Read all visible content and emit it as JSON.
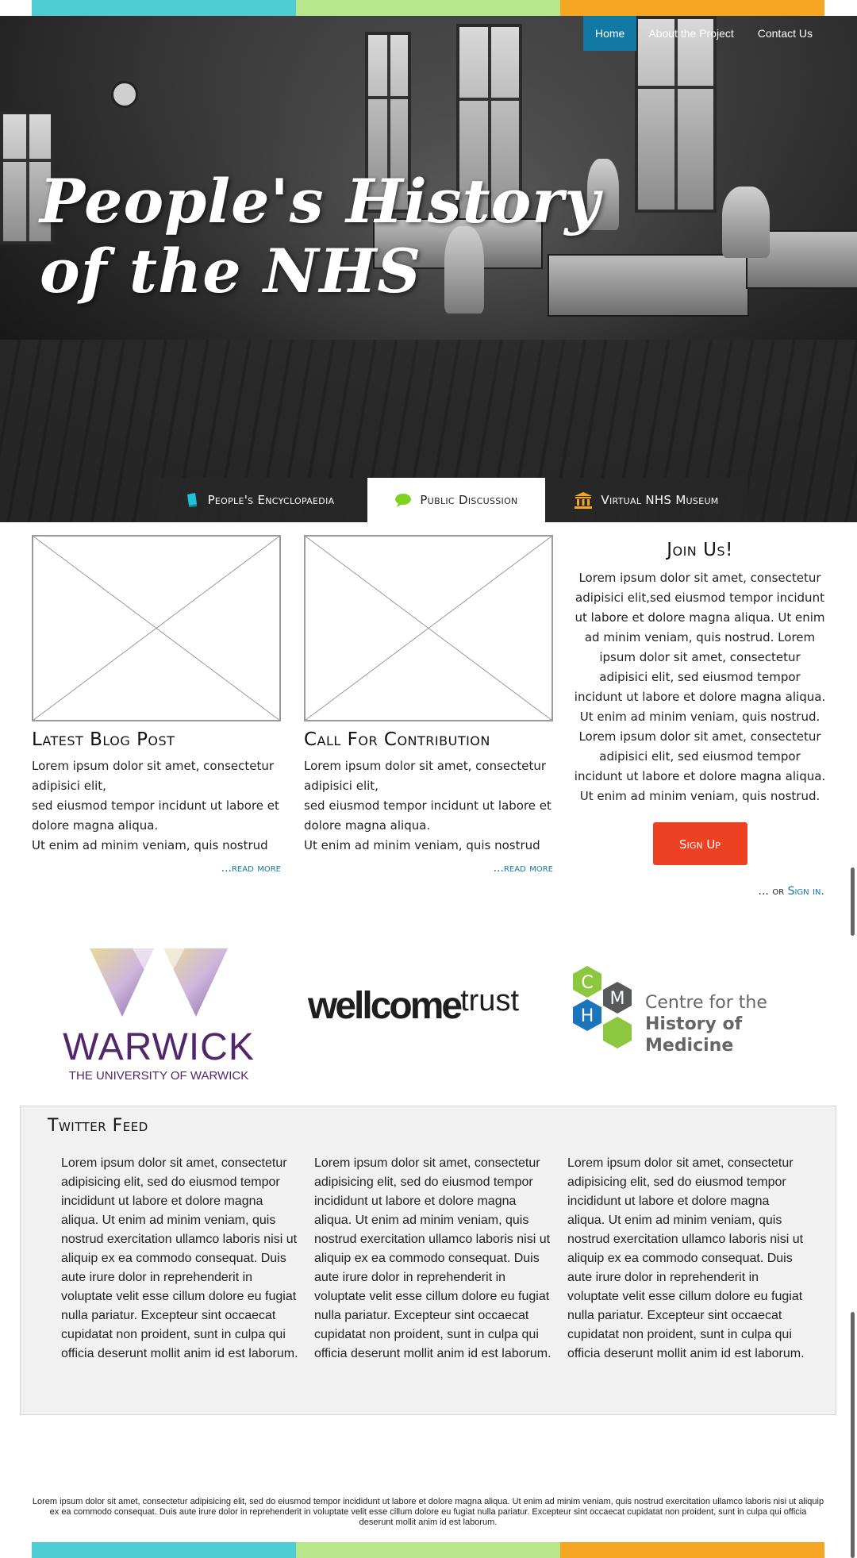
{
  "colors": {
    "teal": "#4ecdd4",
    "green": "#b8e68a",
    "orange": "#f5a623",
    "nav_active": "#1279a4",
    "signup": "#ee4124",
    "link": "#1279a4"
  },
  "nav": {
    "items": [
      {
        "label": "Home",
        "active": true
      },
      {
        "label": "About the Project",
        "active": false
      },
      {
        "label": "Contact Us",
        "active": false
      }
    ]
  },
  "hero": {
    "title_line1": "People's History",
    "title_line2": "of the NHS"
  },
  "tabs": [
    {
      "label": "People's Encyclopaedia",
      "icon": "book-icon",
      "active": false
    },
    {
      "label": "Public Discussion",
      "icon": "speech-bubble-icon",
      "active": true
    },
    {
      "label": "Virtual NHS Museum",
      "icon": "museum-icon",
      "active": false
    }
  ],
  "cards": [
    {
      "title": "Latest Blog Post",
      "body": "Lorem ipsum dolor sit amet, consectetur adipisici elit,\nsed eiusmod tempor incidunt ut labore et dolore magna aliqua.\nUt enim ad minim veniam, quis nostrud",
      "read_more": "...read more"
    },
    {
      "title": "Call For Contribution",
      "body": "Lorem ipsum dolor sit amet, consectetur adipisici elit,\nsed eiusmod tempor incidunt ut labore et dolore magna aliqua.\nUt enim ad minim veniam, quis nostrud",
      "read_more": "...read more"
    }
  ],
  "join": {
    "title": "Join Us!",
    "body": "Lorem ipsum dolor sit amet, consectetur adipisici elit,sed eiusmod tempor incidunt ut labore et dolore magna aliqua. Ut enim ad minim veniam, quis nostrud. Lorem ipsum dolor sit amet, consectetur adipisici elit, sed eiusmod tempor incidunt ut labore et dolore magna aliqua. Ut enim ad minim veniam, quis nostrud. Lorem ipsum dolor sit amet, consectetur adipisici elit, sed eiusmod tempor incidunt ut labore et dolore magna aliqua. Ut enim ad minim veniam, quis nostrud.",
    "signup_label": "Sign Up",
    "or_text": "... or ",
    "signin_label": "Sign in."
  },
  "logos": {
    "warwick": {
      "word": "WARWICK",
      "sub": "THE UNIVERSITY OF WARWICK"
    },
    "wellcome": {
      "bold": "wellcome",
      "light": "trust"
    },
    "chm": {
      "letters": [
        "C",
        "M",
        "H"
      ],
      "line1": "Centre for the",
      "line2": "History of Medicine"
    }
  },
  "twitter": {
    "title": "Twitter Feed",
    "tweets": [
      "Lorem ipsum dolor sit amet, consectetur adipisicing elit, sed do eiusmod tempor incididunt ut labore et dolore magna aliqua. Ut enim ad minim veniam, quis nostrud exercitation ullamco laboris nisi ut aliquip ex ea commodo consequat. Duis aute irure dolor in reprehenderit in voluptate velit esse cillum dolore eu fugiat nulla pariatur. Excepteur sint occaecat cupidatat non proident, sunt in culpa qui officia deserunt mollit anim id est laborum.",
      "Lorem ipsum dolor sit amet, consectetur adipisicing elit, sed do eiusmod tempor incididunt ut labore et dolore magna aliqua. Ut enim ad minim veniam, quis nostrud exercitation ullamco laboris nisi ut aliquip ex ea commodo consequat. Duis aute irure dolor in reprehenderit in voluptate velit esse cillum dolore eu fugiat nulla pariatur. Excepteur sint occaecat cupidatat non proident, sunt in culpa qui officia deserunt mollit anim id est laborum.",
      "Lorem ipsum dolor sit amet, consectetur adipisicing elit, sed do eiusmod tempor incididunt ut labore et dolore magna aliqua. Ut enim ad minim veniam, quis nostrud exercitation ullamco laboris nisi ut aliquip ex ea commodo consequat. Duis aute irure dolor in reprehenderit in voluptate velit esse cillum dolore eu fugiat nulla pariatur. Excepteur sint occaecat cupidatat non proident, sunt in culpa qui officia deserunt mollit anim id est laborum."
    ]
  },
  "footer": {
    "text": "Lorem ipsum dolor sit amet, consectetur adipisicing elit, sed do eiusmod tempor incididunt ut labore et dolore magna aliqua. Ut enim ad minim veniam, quis nostrud exercitation ullamco laboris nisi ut aliquip ex ea commodo consequat. Duis aute irure dolor in reprehenderit in voluptate velit esse cillum dolore eu fugiat nulla pariatur. Excepteur sint occaecat cupidatat non proident, sunt in culpa qui officia deserunt mollit anim id est laborum."
  }
}
